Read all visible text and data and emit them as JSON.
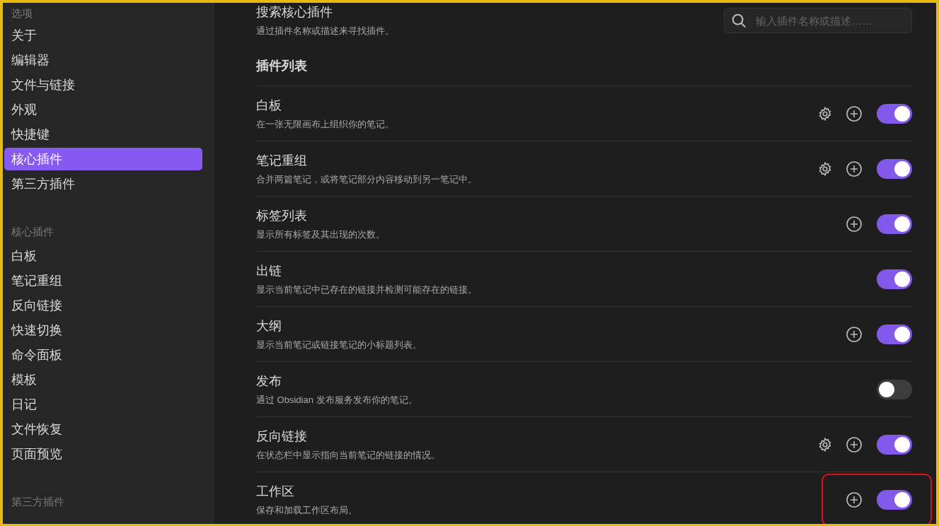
{
  "sidebar": {
    "sections": [
      {
        "heading": "选项",
        "items": [
          {
            "label": "关于",
            "selected": false
          },
          {
            "label": "编辑器",
            "selected": false
          },
          {
            "label": "文件与链接",
            "selected": false
          },
          {
            "label": "外观",
            "selected": false
          },
          {
            "label": "快捷键",
            "selected": false
          },
          {
            "label": "核心插件",
            "selected": true
          },
          {
            "label": "第三方插件",
            "selected": false
          }
        ]
      },
      {
        "heading": "核心插件",
        "items": [
          {
            "label": "白板",
            "selected": false
          },
          {
            "label": "笔记重组",
            "selected": false
          },
          {
            "label": "反向链接",
            "selected": false
          },
          {
            "label": "快速切换",
            "selected": false
          },
          {
            "label": "命令面板",
            "selected": false
          },
          {
            "label": "模板",
            "selected": false
          },
          {
            "label": "日记",
            "selected": false
          },
          {
            "label": "文件恢复",
            "selected": false
          },
          {
            "label": "页面预览",
            "selected": false
          }
        ]
      },
      {
        "heading": "第三方插件"
      }
    ]
  },
  "search": {
    "title": "搜索核心插件",
    "description": "通过插件名称或描述来寻找插件。",
    "placeholder": "输入插件名称或描述……"
  },
  "list_heading": "插件列表",
  "plugins": [
    {
      "name": "白板",
      "description": "在一张无限画布上组织你的笔记。",
      "settings_button": true,
      "hotkey_button": true,
      "enabled": true,
      "highlighted": false
    },
    {
      "name": "笔记重组",
      "description": "合并两篇笔记，或将笔记部分内容移动到另一笔记中。",
      "settings_button": true,
      "hotkey_button": true,
      "enabled": true,
      "highlighted": false
    },
    {
      "name": "标签列表",
      "description": "显示所有标签及其出现的次数。",
      "settings_button": false,
      "hotkey_button": true,
      "enabled": true,
      "highlighted": false
    },
    {
      "name": "出链",
      "description": "显示当前笔记中已存在的链接并检测可能存在的链接。",
      "settings_button": false,
      "hotkey_button": false,
      "enabled": true,
      "highlighted": false
    },
    {
      "name": "大纲",
      "description": "显示当前笔记或链接笔记的小标题列表。",
      "settings_button": false,
      "hotkey_button": true,
      "enabled": true,
      "highlighted": false
    },
    {
      "name": "发布",
      "description": "通过 Obsidian 发布服务发布你的笔记。",
      "settings_button": false,
      "hotkey_button": false,
      "enabled": false,
      "highlighted": false
    },
    {
      "name": "反向链接",
      "description": "在状态栏中显示指向当前笔记的链接的情况。",
      "settings_button": true,
      "hotkey_button": true,
      "enabled": true,
      "highlighted": false
    },
    {
      "name": "工作区",
      "description": "保存和加载工作区布局。",
      "settings_button": false,
      "hotkey_button": true,
      "enabled": true,
      "highlighted": true
    }
  ]
}
